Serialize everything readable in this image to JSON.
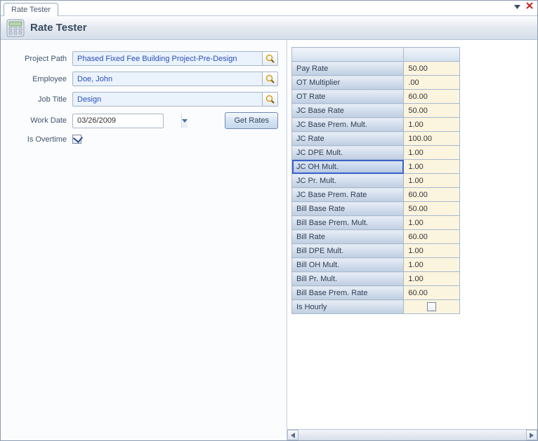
{
  "tab": {
    "label": "Rate Tester"
  },
  "title": "Rate Tester",
  "form": {
    "project_path_label": "Project Path",
    "project_path_value": "Phased Fixed Fee Building Project-Pre-Design",
    "employee_label": "Employee",
    "employee_value": "Doe, John",
    "job_title_label": "Job Title",
    "job_title_value": "Design",
    "work_date_label": "Work Date",
    "work_date_value": "03/26/2009",
    "is_overtime_label": "Is Overtime",
    "is_overtime_checked": true,
    "get_rates_label": "Get Rates"
  },
  "rates": [
    {
      "label": "Pay Rate",
      "value": "50.00"
    },
    {
      "label": "OT Multiplier",
      "value": ".00"
    },
    {
      "label": "OT Rate",
      "value": "60.00"
    },
    {
      "label": "JC Base Rate",
      "value": "50.00"
    },
    {
      "label": "JC Base Prem. Mult.",
      "value": "1.00"
    },
    {
      "label": "JC Rate",
      "value": "100.00"
    },
    {
      "label": "JC DPE Mult.",
      "value": "1.00"
    },
    {
      "label": "JC OH Mult.",
      "value": "1.00",
      "selected": true
    },
    {
      "label": "JC Pr. Mult.",
      "value": "1.00"
    },
    {
      "label": "JC Base Prem. Rate",
      "value": "60.00"
    },
    {
      "label": "Bill Base Rate",
      "value": "50.00"
    },
    {
      "label": "Bill Base Prem. Mult.",
      "value": "1.00"
    },
    {
      "label": "Bill Rate",
      "value": "60.00"
    },
    {
      "label": "Bill DPE Mult.",
      "value": "1.00"
    },
    {
      "label": "Bill OH Mult.",
      "value": "1.00"
    },
    {
      "label": "Bill Pr. Mult.",
      "value": "1.00"
    },
    {
      "label": "Bill Base Prem. Rate",
      "value": "60.00"
    },
    {
      "label": "Is Hourly",
      "value": "",
      "checkbox": true,
      "checked": false
    }
  ]
}
